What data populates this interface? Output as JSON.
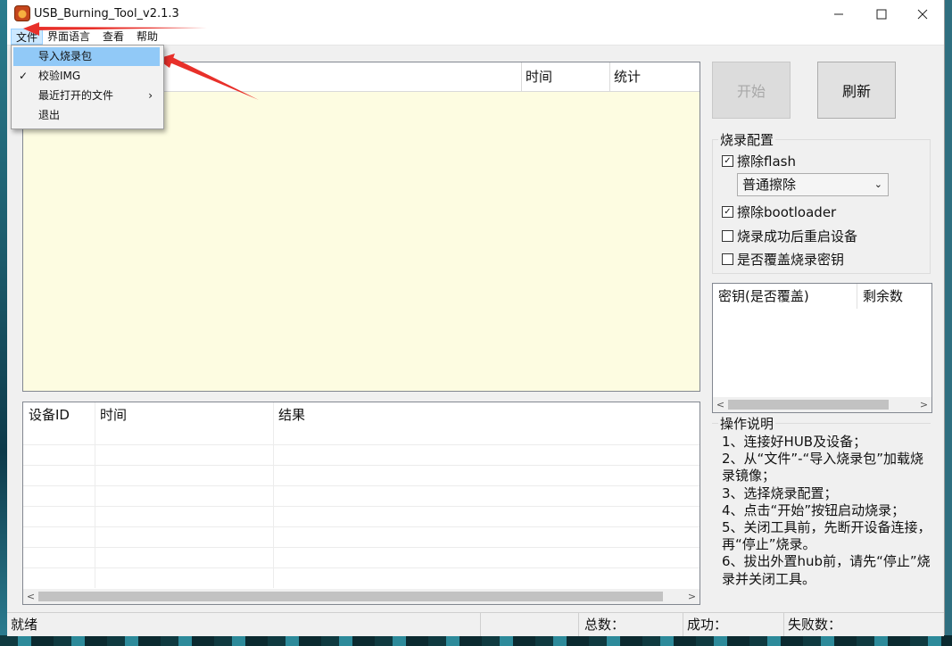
{
  "window": {
    "title": "USB_Burning_Tool_v2.1.3"
  },
  "menubar": {
    "items": [
      "文件",
      "界面语言",
      "查看",
      "帮助"
    ]
  },
  "file_menu": {
    "items": [
      {
        "label": "导入烧录包",
        "highlighted": true,
        "checked": false,
        "submenu": false
      },
      {
        "label": "校验IMG",
        "highlighted": false,
        "checked": true,
        "submenu": false
      },
      {
        "label": "最近打开的文件",
        "highlighted": false,
        "checked": false,
        "submenu": true
      },
      {
        "label": "退出",
        "highlighted": false,
        "checked": false,
        "submenu": false
      }
    ]
  },
  "main_list": {
    "columns": [
      "时间",
      "统计"
    ]
  },
  "device_table": {
    "columns": [
      "设备ID",
      "时间",
      "结果"
    ],
    "rows": []
  },
  "buttons": {
    "start": "开始",
    "refresh": "刷新"
  },
  "burn_config": {
    "title": "烧录配置",
    "erase_flash": {
      "label": "擦除flash",
      "checked": true
    },
    "erase_mode": "普通擦除",
    "erase_bootloader": {
      "label": "擦除bootloader",
      "checked": true
    },
    "reboot_after": {
      "label": "烧录成功后重启设备",
      "checked": false
    },
    "overwrite_key": {
      "label": "是否覆盖烧录密钥",
      "checked": false
    }
  },
  "key_table": {
    "columns": [
      "密钥(是否覆盖)",
      "剩余数"
    ]
  },
  "instructions": {
    "title": "操作说明",
    "text": "1、连接好HUB及设备；\n2、从“文件”-“导入烧录包”加载烧录镜像；\n3、选择烧录配置；\n4、点击“开始”按钮启动烧录；\n5、关闭工具前，先断开设备连接，再“停止”烧录。\n6、拔出外置hub前，请先“停止”烧录并关闭工具。"
  },
  "statusbar": {
    "status": "就绪",
    "total": "总数：",
    "success": "成功：",
    "fail": "失败数："
  },
  "colors": {
    "list_bg": "#fdfce1",
    "highlight": "#91c9f7",
    "annotation_arrow": "#e8302a"
  }
}
